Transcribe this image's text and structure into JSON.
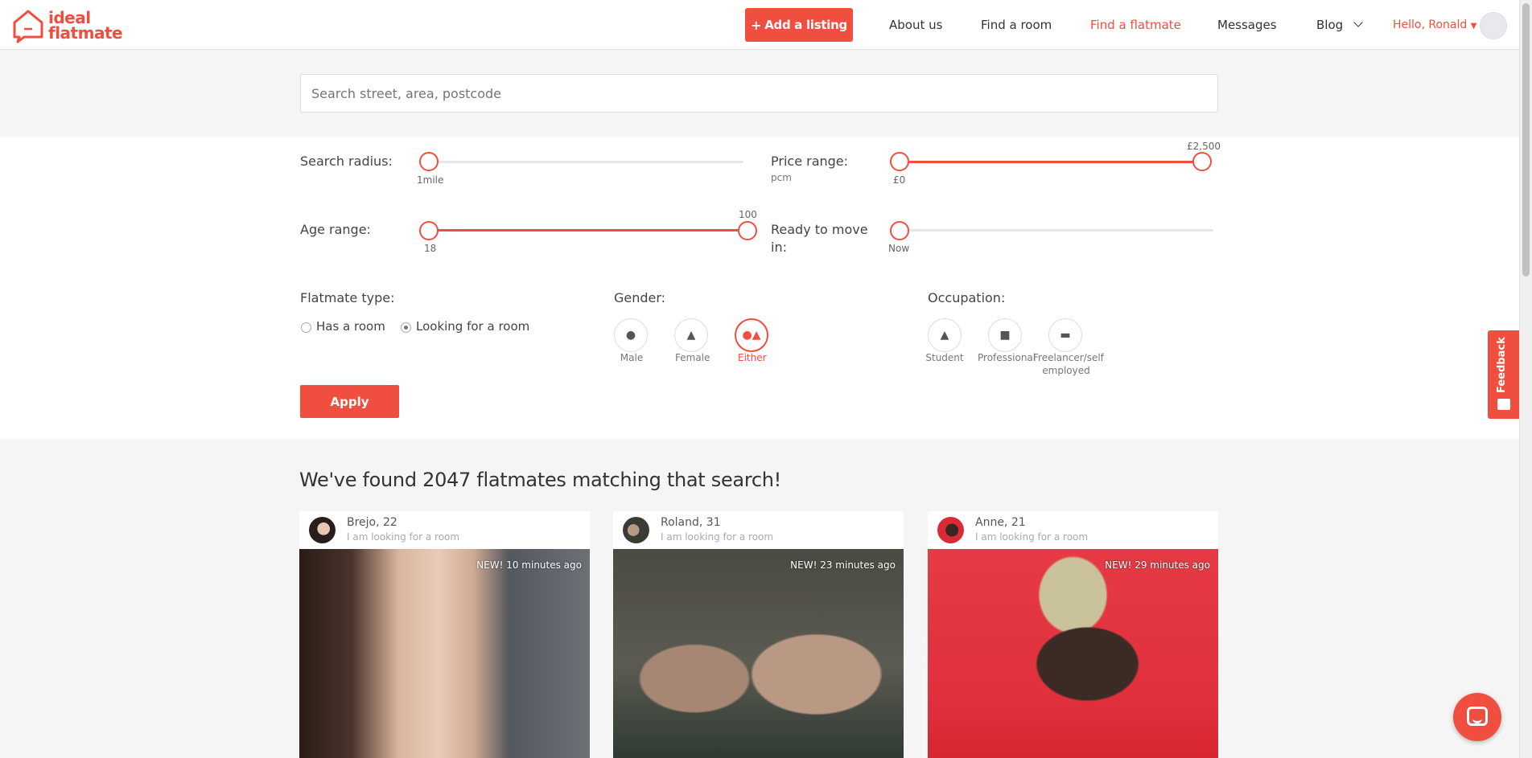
{
  "header": {
    "logo_line1": "ideal",
    "logo_line2": "flatmate",
    "add_listing": "Add a listing",
    "nav": [
      "About us",
      "Find a room",
      "Find a flatmate",
      "Messages",
      "Blog"
    ],
    "active_nav": "Find a flatmate",
    "greeting": "Hello, Ronald"
  },
  "search": {
    "placeholder": "Search street, area, postcode",
    "value": ""
  },
  "filters": {
    "radius": {
      "label": "Search radius:",
      "value_label": "1mile",
      "fraction": 0.0
    },
    "price": {
      "label": "Price range:",
      "unit": "pcm",
      "min_label": "£0",
      "max_label": "£2,500"
    },
    "age": {
      "label": "Age range:",
      "min_label": "18",
      "max_label": "100"
    },
    "move_in": {
      "label_1": "Ready to move",
      "label_2": "in:",
      "value_label": "Now"
    },
    "flatmate_type": {
      "label": "Flatmate type:",
      "options": [
        "Has a room",
        "Looking for a room"
      ],
      "selected": "Looking for a room"
    },
    "gender": {
      "label": "Gender:",
      "options": [
        "Male",
        "Female",
        "Either"
      ],
      "selected": "Either"
    },
    "occupation": {
      "label": "Occupation:",
      "options": [
        "Student",
        "Professional",
        "Freelancer/self",
        "employed"
      ]
    },
    "apply": "Apply"
  },
  "feedback": "Feedback",
  "results": {
    "title": "We've found 2047 flatmates matching that search!",
    "cards": [
      {
        "name": "Brejo, 22",
        "sub": "I am looking for a room",
        "badge": "NEW! 10 minutes ago"
      },
      {
        "name": "Roland, 31",
        "sub": "I am looking for a room",
        "badge": "NEW! 23 minutes ago"
      },
      {
        "name": "Anne, 21",
        "sub": "I am looking for a room",
        "badge": "NEW! 29 minutes ago"
      }
    ]
  },
  "colors": {
    "brand": "#f04e3e",
    "panel": "#ffffff",
    "background": "#f5f5f5"
  }
}
